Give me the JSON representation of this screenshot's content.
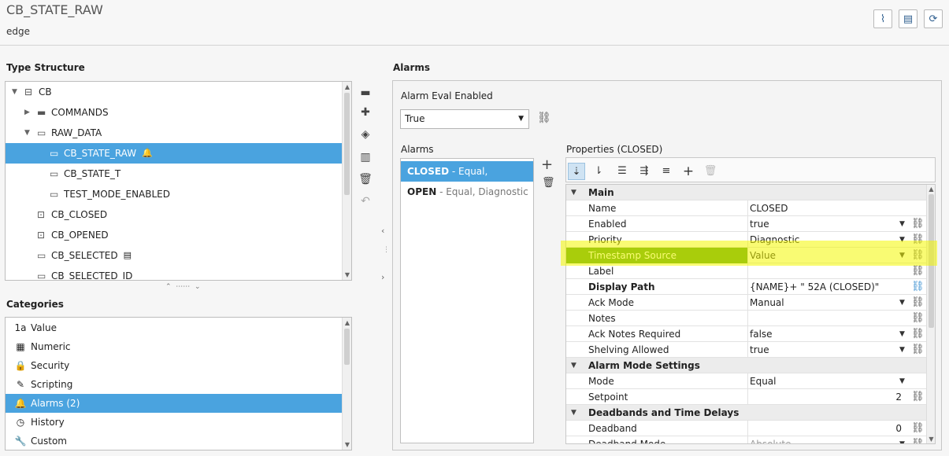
{
  "header": {
    "title": "CB_STATE_RAW",
    "provider": "edge",
    "buttons": [
      {
        "name": "diagnostics-button",
        "icon": "pulse-icon"
      },
      {
        "name": "notes-button",
        "icon": "note-icon"
      },
      {
        "name": "refresh-button",
        "icon": "refresh-icon"
      }
    ]
  },
  "type_structure": {
    "heading": "Type Structure",
    "items": [
      {
        "label": "CB",
        "icon": "udt-instance-icon",
        "indent": 0,
        "expand": "down"
      },
      {
        "label": "COMMANDS",
        "icon": "folder-icon",
        "indent": 1,
        "expand": "right"
      },
      {
        "label": "RAW_DATA",
        "icon": "folder-open-icon",
        "indent": 1,
        "expand": "down"
      },
      {
        "label": "CB_STATE_RAW",
        "icon": "tag-icon",
        "indent": 2,
        "expand": "",
        "selected": true,
        "badge": "bell-icon"
      },
      {
        "label": "CB_STATE_T",
        "icon": "tag-icon",
        "indent": 2,
        "expand": ""
      },
      {
        "label": "TEST_MODE_ENABLED",
        "icon": "tag-icon",
        "indent": 2,
        "expand": ""
      },
      {
        "label": "CB_CLOSED",
        "icon": "expression-tag-icon",
        "indent": 1,
        "expand": ""
      },
      {
        "label": "CB_OPENED",
        "icon": "expression-tag-icon",
        "indent": 1,
        "expand": ""
      },
      {
        "label": "CB_SELECTED",
        "icon": "tag-icon",
        "indent": 1,
        "expand": "",
        "badge": "document-icon"
      },
      {
        "label": "CB_SELECTED_ID",
        "icon": "tag-icon",
        "indent": 1,
        "expand": ""
      }
    ]
  },
  "categories": {
    "heading": "Categories",
    "items": [
      {
        "label": "Value",
        "icon": "value-icon",
        "glyph": "1a"
      },
      {
        "label": "Numeric",
        "icon": "calculator-icon",
        "glyph": "▦"
      },
      {
        "label": "Security",
        "icon": "lock-icon",
        "glyph": "🔒"
      },
      {
        "label": "Scripting",
        "icon": "script-icon",
        "glyph": "✎"
      },
      {
        "label": "Alarms (2)",
        "icon": "bell-icon",
        "glyph": "🔔",
        "selected": true
      },
      {
        "label": "History",
        "icon": "clock-icon",
        "glyph": "◷"
      },
      {
        "label": "Custom",
        "icon": "wrench-icon",
        "glyph": "🔧"
      }
    ]
  },
  "alarms": {
    "heading": "Alarms",
    "eval_label": "Alarm Eval Enabled",
    "eval_value": "True",
    "list_label": "Alarms",
    "list": [
      {
        "name": "CLOSED",
        "desc": " - Equal, Diagnostic",
        "selected": true
      },
      {
        "name": "OPEN",
        "desc": " - Equal, Diagnostic",
        "selected": false
      }
    ],
    "props_label": "Properties (CLOSED)"
  },
  "properties": [
    {
      "type": "group",
      "name": "Main"
    },
    {
      "name": "Name",
      "value": "CLOSED",
      "dd": false,
      "link": false
    },
    {
      "name": "Enabled",
      "value": "true",
      "dd": true,
      "link": true
    },
    {
      "name": "Priority",
      "value": "Diagnostic",
      "dd": true,
      "link": true
    },
    {
      "name": "Timestamp Source",
      "value": "Value",
      "dd": true,
      "link": true,
      "selected": true
    },
    {
      "name": "Label",
      "value": "",
      "dd": false,
      "link": true
    },
    {
      "name": "Display Path",
      "value": "{NAME}+ \" 52A (CLOSED)\"",
      "dd": false,
      "link": true,
      "bold": true,
      "linkActive": true
    },
    {
      "name": "Ack Mode",
      "value": "Manual",
      "dd": true,
      "link": true
    },
    {
      "name": "Notes",
      "value": "",
      "dd": false,
      "link": true
    },
    {
      "name": "Ack Notes Required",
      "value": "false",
      "dd": true,
      "link": true
    },
    {
      "name": "Shelving Allowed",
      "value": "true",
      "dd": true,
      "link": true
    },
    {
      "type": "group",
      "name": "Alarm Mode Settings"
    },
    {
      "name": "Mode",
      "value": "Equal",
      "dd": true,
      "link": false
    },
    {
      "name": "Setpoint",
      "value": "2",
      "dd": false,
      "link": true,
      "right": true
    },
    {
      "type": "group",
      "name": "Deadbands and Time Delays"
    },
    {
      "name": "Deadband",
      "value": "0",
      "dd": false,
      "link": true,
      "right": true
    },
    {
      "name": "Deadband Mode",
      "value": "Absolute",
      "dd": true,
      "link": true,
      "clipped": true
    }
  ],
  "colors": {
    "selection": "#4aa3df",
    "highlight": "#f4f700",
    "row_selected": "#4e9a1a"
  }
}
